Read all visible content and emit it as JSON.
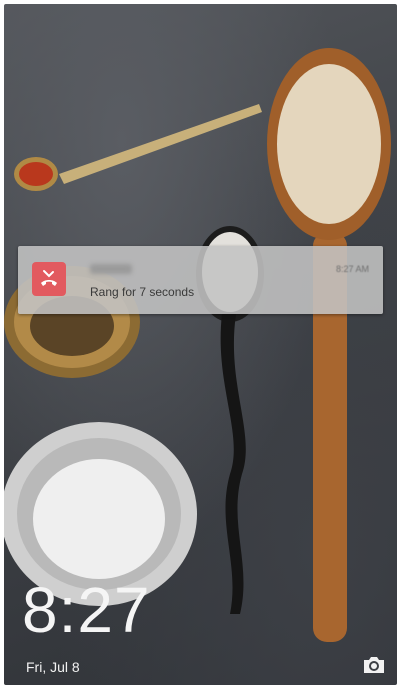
{
  "notification": {
    "caller": "",
    "time": "8:27 AM",
    "message": "Rang for 7 seconds",
    "icon": "missed-call-icon"
  },
  "lockscreen": {
    "time": "8:27",
    "date": "Fri, Jul 8"
  },
  "camera": {
    "icon": "camera-icon"
  },
  "colors": {
    "missed_call_accent": "#e25a5f"
  }
}
